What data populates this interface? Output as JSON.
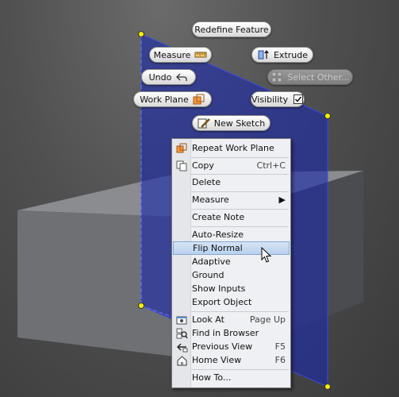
{
  "marking_menu": {
    "redefine_feature": "Redefine Feature",
    "measure": "Measure",
    "extrude": "Extrude",
    "undo": "Undo",
    "select_other": "Select Other...",
    "work_plane": "Work Plane",
    "visibility": "Visibility",
    "new_sketch": "New Sketch"
  },
  "context_menu": {
    "items": [
      {
        "label": "Repeat Work Plane",
        "shortcut": "",
        "icon": "work-plane-icon"
      },
      {
        "label": "Copy",
        "shortcut": "Ctrl+C",
        "icon": "copy-icon"
      },
      {
        "label": "Delete",
        "shortcut": ""
      },
      {
        "label": "Measure",
        "shortcut": "",
        "submenu": true
      },
      {
        "label": "Create Note",
        "shortcut": ""
      },
      {
        "label": "Auto-Resize",
        "shortcut": ""
      },
      {
        "label": "Flip Normal",
        "shortcut": "",
        "highlighted": true
      },
      {
        "label": "Adaptive",
        "shortcut": ""
      },
      {
        "label": "Ground",
        "shortcut": ""
      },
      {
        "label": "Show Inputs",
        "shortcut": ""
      },
      {
        "label": "Export Object",
        "shortcut": ""
      },
      {
        "label": "Look At",
        "shortcut": "Page Up",
        "icon": "look-at-icon"
      },
      {
        "label": "Find in Browser",
        "shortcut": "",
        "icon": "find-in-browser-icon"
      },
      {
        "label": "Previous View",
        "shortcut": "F5",
        "icon": "previous-view-icon"
      },
      {
        "label": "Home View",
        "shortcut": "F6",
        "icon": "home-view-icon"
      },
      {
        "label": "How To...",
        "shortcut": ""
      }
    ]
  },
  "colors": {
    "work_plane_fill": "#1c2aa8",
    "menu_highlight": "#b9d1ee",
    "viewport_bg": "#505050"
  }
}
